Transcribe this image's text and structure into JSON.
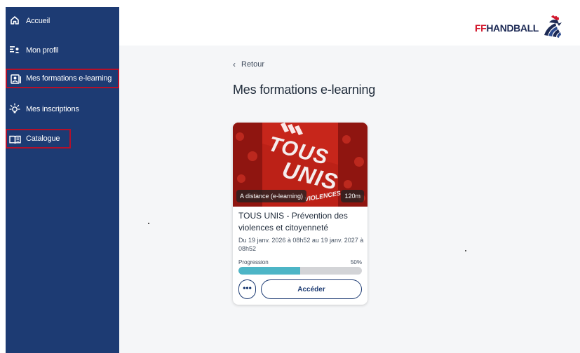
{
  "nav": {
    "items": [
      {
        "label": "Accueil",
        "icon": "home-icon"
      },
      {
        "label": "Mon profil",
        "icon": "profile-icon"
      },
      {
        "label": "Mes formations e-learning",
        "icon": "elearning-icon"
      },
      {
        "label": "Mes inscriptions",
        "icon": "lightbulb-icon"
      },
      {
        "label": "Catalogue",
        "icon": "book-icon"
      }
    ]
  },
  "brand": {
    "prefix": "FF",
    "suffix": "HANDBALL"
  },
  "main": {
    "back_label": "Retour",
    "title": "Mes formations e-learning"
  },
  "card": {
    "image_text_1": "TOUS",
    "image_text_2": "UNIS",
    "image_text_3": "VIOLENCES",
    "mode_badge": "A distance (e-learning)",
    "duration_badge": "120m",
    "title": "TOUS UNIS - Prévention des violences et citoyenneté",
    "dates": "Du 19 janv. 2026 à 08h52 au 19 janv. 2027 à 08h52",
    "progress_label": "Progression",
    "progress_text": "50%",
    "progress_value": 0.5,
    "more_label": "•••",
    "access_label": "Accéder"
  },
  "colors": {
    "sidebar": "#1d3b73",
    "highlight_border": "#b4102a",
    "progress": "#4db5c6",
    "brand_red": "#d2162b"
  }
}
